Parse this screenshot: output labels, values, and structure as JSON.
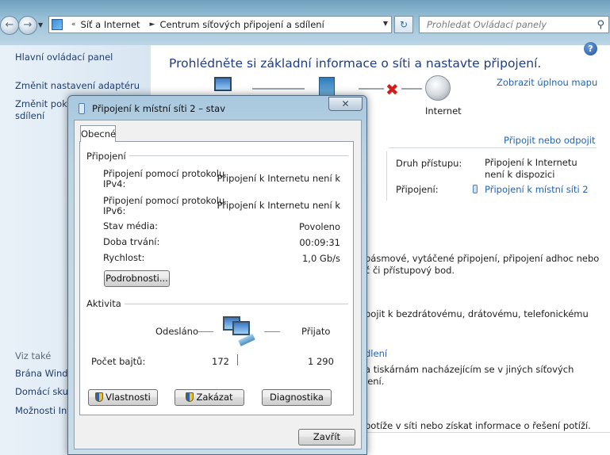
{
  "address_bar": {
    "crumbs": [
      "Síť a Internet",
      "Centrum síťových připojení a sdílení"
    ],
    "search_placeholder": "Prohledat Ovládací panely"
  },
  "left_pane": {
    "links": [
      "Hlavní ovládací panel",
      "Změnit nastavení adaptéru",
      "Změnit pokro",
      "sdílení"
    ],
    "see_also_heading": "Viz také",
    "see_also": [
      "Brána Windo",
      "Domácí skup",
      "Možnosti Int"
    ]
  },
  "main": {
    "title": "Prohlédněte si základní informace o síti a nastavte připojení.",
    "full_map_link": "Zobrazit úplnou mapu",
    "internet_label": "Internet",
    "connect_link": "Připojit nebo odpojit",
    "access_type_label": "Druh přístupu:",
    "access_type_value_1": "Připojení k Internetu",
    "access_type_value_2": "není k dispozici",
    "connections_label": "Připojení:",
    "connections_value": "Připojení k místní síti 2",
    "text1_l1": "pásmové, vytáčené připojení, připojení adhoc nebo",
    "text1_l2": "č či přístupový bod.",
    "text2": "pojit k bezdrátovému, drátovému, telefonickému",
    "link3": "dlení",
    "text3_l1": "a tiskárnám nacházejícím se v jiných síťových",
    "text3_l2": "lení.",
    "text4": "potíže v síti nebo získat informace o řešení potíží."
  },
  "dialog": {
    "title": "Připojení k místní síti 2 – stav",
    "close_glyph": "✕",
    "tab": "Obecné",
    "group_connection": "Připojení",
    "ipv4_label_1": "Připojení pomocí protokolu",
    "ipv4_label_2": "IPv4:",
    "ipv4_value": "Připojení k Internetu není k",
    "ipv6_label_1": "Připojení pomocí protokolu",
    "ipv6_label_2": "IPv6:",
    "ipv6_value": "Připojení k Internetu není k",
    "media_label": "Stav média:",
    "media_value": "Povoleno",
    "duration_label": "Doba trvání:",
    "duration_value": "00:09:31",
    "speed_label": "Rychlost:",
    "speed_value": "1,0 Gb/s",
    "details_button": "Podrobnosti...",
    "group_activity": "Aktivita",
    "sent_label": "Odesláno",
    "received_label": "Přijato",
    "bytes_label": "Počet bajtů:",
    "bytes_sent": "172",
    "bytes_received": "1 290",
    "properties_button": "Vlastnosti",
    "disable_button": "Zakázat",
    "diagnose_button": "Diagnostika",
    "close_button": "Zavřít"
  }
}
